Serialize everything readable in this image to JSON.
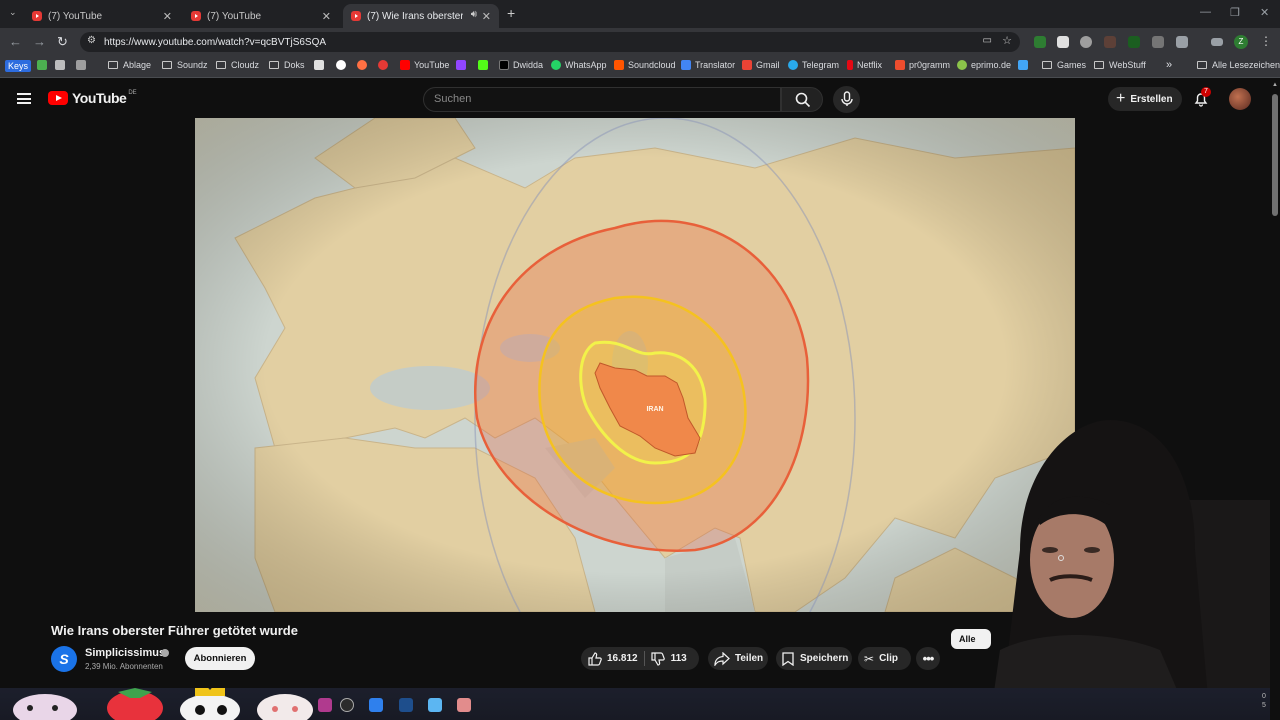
{
  "browser": {
    "tabs": [
      {
        "title": "(7) YouTube",
        "active": false
      },
      {
        "title": "(7) YouTube",
        "active": false
      },
      {
        "title": "(7) Wie Irans oberster Führ...",
        "active": true
      }
    ],
    "new_tab": "+",
    "url": "https://www.youtube.com/watch?v=qcBVTjS6SQA",
    "bookmarks": [
      "Keys",
      "Ablage",
      "Soundz",
      "Cloudz",
      "Doks",
      "YouTube",
      "Dwidda",
      "WhatsApp",
      "Soundcloud",
      "Translator",
      "Gmail",
      "Telegram",
      "Netflix",
      "pr0gramm",
      "eprimo.de",
      "Games",
      "WebStuff"
    ],
    "bookmarks_overflow": "»",
    "all_bookmarks": "Alle Lesezeichen",
    "profile_letter": "Z"
  },
  "youtube": {
    "logo": "YouTube",
    "country_code": "DE",
    "search_placeholder": "Suchen",
    "create_label": "Erstellen",
    "notification_count": "7"
  },
  "video": {
    "map_label": "IRAN",
    "title": "Wie Irans oberster Führer getötet wurde",
    "channel": {
      "initial": "S",
      "name": "Simplicissimus",
      "subscribers": "2,39 Mio. Abonnenten"
    },
    "subscribe_label": "Abonnieren",
    "likes": "16.812",
    "dislikes": "113",
    "share_label": "Teilen",
    "save_label": "Speichern",
    "clip_label": "Clip",
    "chip_label": "Alle"
  },
  "taskbar": {
    "tray_top": "0",
    "tray_bottom": "5"
  },
  "colors": {
    "youtube_red": "#ff0000",
    "ring_outer": "#e8603a",
    "ring_middle": "#f5c21f",
    "ring_inner": "#f2f24a",
    "iran_fill": "#f0884a"
  }
}
